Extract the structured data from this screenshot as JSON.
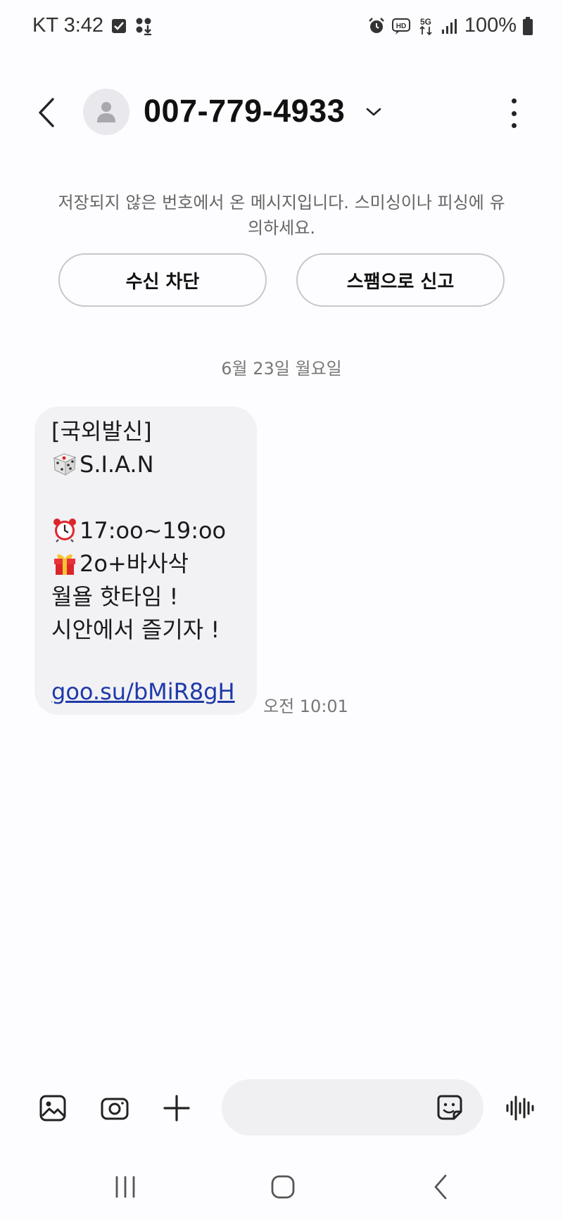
{
  "status_bar": {
    "carrier_time": "KT 3:42",
    "battery": "100%"
  },
  "header": {
    "contact_number": "007-779-4933"
  },
  "notice": {
    "text": "저장되지 않은 번호에서 온 메시지입니다. 스미싱이나 피싱에 유의하세요.",
    "block_label": "수신 차단",
    "report_label": "스팸으로 신고"
  },
  "conversation": {
    "date": "6월 23일 월요일",
    "message": {
      "line1": "[국외발신]",
      "line2": "S.I.A.N",
      "line3": "17:oo~19:oo",
      "line4": "2o+바사삭",
      "line5": "월욜 핫타임 !",
      "line6": "시안에서 즐기자 !",
      "link": "goo.su/bMiR8gH",
      "time": "오전 10:01"
    }
  },
  "composer": {
    "placeholder": ""
  },
  "colors": {
    "background": "#fdfcfe",
    "bubble": "#f2f1f4",
    "link": "#1e3aa8",
    "muted_text": "#777777"
  },
  "icons": {
    "status": [
      "checkbox-icon",
      "apps-download-icon",
      "alarm-icon",
      "hd-voice-icon",
      "5g-icon",
      "signal-icon",
      "battery-icon"
    ],
    "header": [
      "back-arrow-icon",
      "contact-avatar-icon",
      "chevron-down-icon",
      "more-vert-icon"
    ],
    "message_emojis": [
      "dice-emoji",
      "alarm-clock-emoji",
      "gift-emoji"
    ],
    "composer": [
      "gallery-icon",
      "camera-icon",
      "plus-icon",
      "sticker-icon",
      "voice-wave-icon"
    ],
    "nav": [
      "recents-icon",
      "home-icon",
      "back-icon"
    ]
  }
}
